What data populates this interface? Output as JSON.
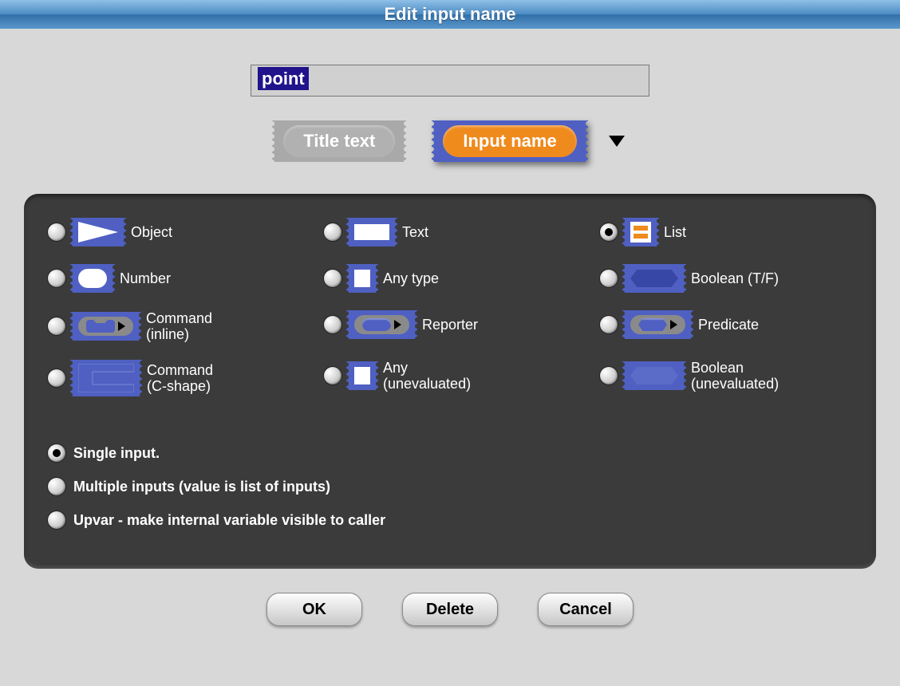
{
  "title": "Edit input name",
  "name_value": "point",
  "mode": {
    "title_text_label": "Title text",
    "input_name_label": "Input name"
  },
  "types": {
    "object": "Object",
    "text": "Text",
    "list": "List",
    "number": "Number",
    "anytype": "Any type",
    "boolean": "Boolean (T/F)",
    "cmd_inline": "Command\n(inline)",
    "reporter": "Reporter",
    "predicate": "Predicate",
    "cmd_cshape": "Command\n(C-shape)",
    "any_uneval": "Any\n(unevaluated)",
    "bool_uneval": "Boolean\n(unevaluated)"
  },
  "arity": {
    "single": "Single input.",
    "multiple": "Multiple inputs (value is list of inputs)",
    "upvar": "Upvar - make internal variable visible to caller"
  },
  "buttons": {
    "ok": "OK",
    "delete": "Delete",
    "cancel": "Cancel"
  }
}
